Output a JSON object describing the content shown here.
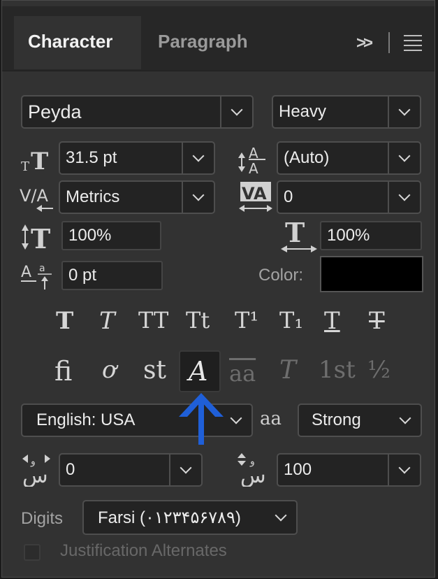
{
  "tabs": [
    {
      "label": "Character",
      "active": true
    },
    {
      "label": "Paragraph",
      "active": false
    }
  ],
  "panel_menu": {
    "more_label": ">>"
  },
  "font_family": {
    "value": "Peyda"
  },
  "font_style": {
    "value": "Heavy"
  },
  "font_size": {
    "value": "31.5 pt"
  },
  "leading": {
    "value": "(Auto)"
  },
  "kerning": {
    "value": "Metrics"
  },
  "tracking": {
    "value": "0"
  },
  "vertical_scale": {
    "value": "100%"
  },
  "horizontal_scale": {
    "value": "100%"
  },
  "baseline_shift": {
    "value": "0 pt"
  },
  "color": {
    "label": "Color:",
    "swatch": "#000000"
  },
  "type_style_buttons": [
    "T",
    "T",
    "TT",
    "Tt",
    "T¹",
    "T₁",
    "T",
    "T"
  ],
  "opentype_buttons": [
    "ﬁ",
    "ơ",
    "st",
    "A",
    "aa",
    "T",
    "1st",
    "½"
  ],
  "language": {
    "value": "English: USA"
  },
  "anti_alias": {
    "icon_text": "aa",
    "value": "Strong"
  },
  "kashida": {
    "value": "0"
  },
  "diacritic_position": {
    "value": "100"
  },
  "digits": {
    "label": "Digits",
    "value": "Farsi (۰۱۲۳۴۵۶۷۸۹)"
  },
  "justification_alternates": {
    "label": "Justification Alternates",
    "checked": false
  },
  "colors": {
    "accent_arrow": "#1f5fd8",
    "panel_bg": "#323232"
  }
}
